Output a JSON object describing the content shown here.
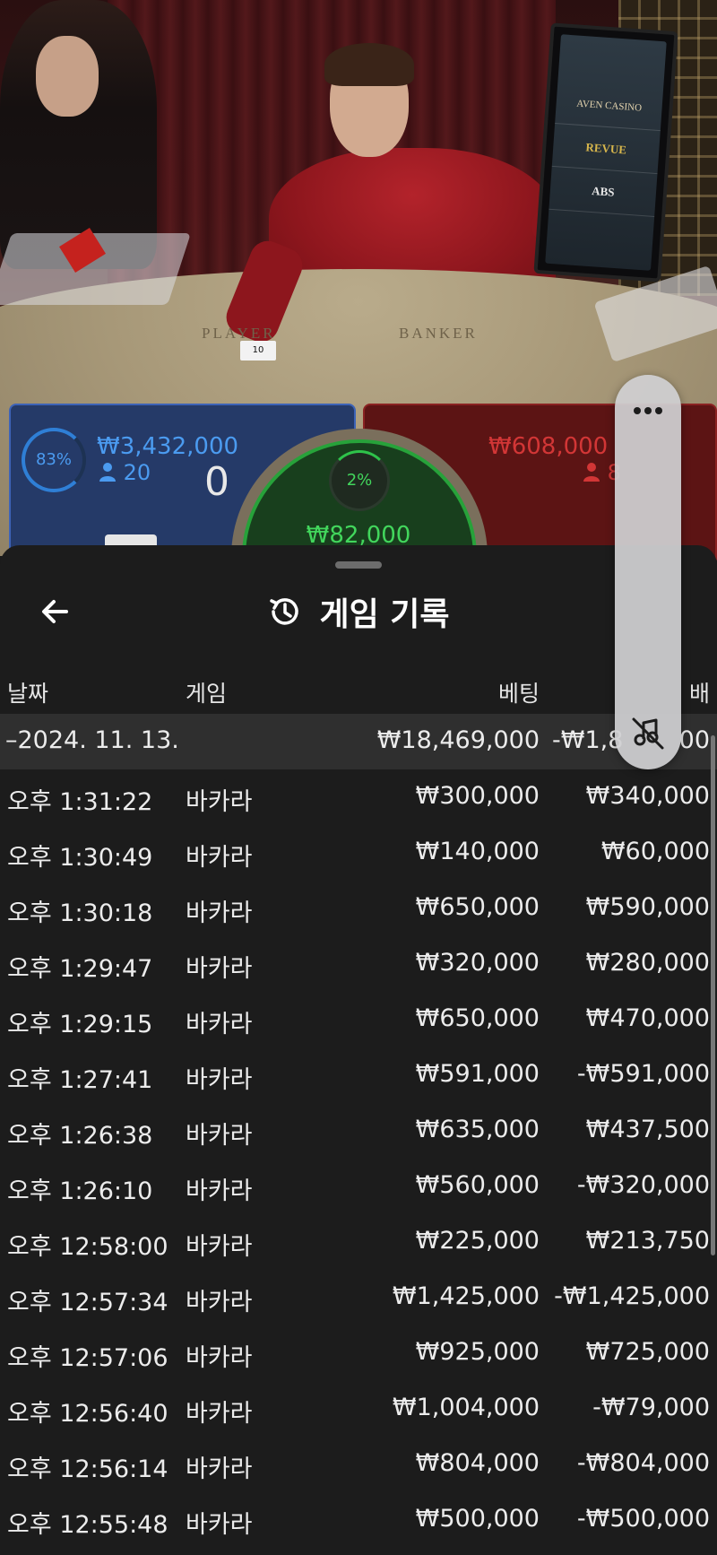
{
  "colors": {
    "player_blue": "#4b9bf0",
    "banker_red": "#d23636",
    "tie_green": "#42d65c",
    "sheet_bg": "#1c1c1c",
    "summary_row_bg": "#2f2f2f"
  },
  "video": {
    "monitor_brands": [
      "AVEN CASINO",
      "REVUE",
      "ABS"
    ],
    "table_labels": {
      "player": "PLAYER",
      "banker": "BANKER"
    },
    "card_value": "10"
  },
  "betting": {
    "player": {
      "percent": "83%",
      "amount": "₩3,432,000",
      "players": "20",
      "score": "0"
    },
    "tie": {
      "percent": "2%",
      "amount": "₩82,000"
    },
    "banker": {
      "amount": "₩608,000",
      "players": "8"
    }
  },
  "history": {
    "title": "게임 기록",
    "title_icon": "history-icon",
    "back_icon": "back-arrow-icon",
    "columns": {
      "date": "날짜",
      "game": "게임",
      "bet": "베팅",
      "payout": "배"
    },
    "summary": {
      "date": "–2024. 11. 13.",
      "bet": "₩18,469,000",
      "payout": "-₩1,8",
      "payout_tail": "00"
    },
    "rows": [
      {
        "time": "오후 1:31:22",
        "game": "바카라",
        "bet": "₩300,000",
        "payout": "₩340,000"
      },
      {
        "time": "오후 1:30:49",
        "game": "바카라",
        "bet": "₩140,000",
        "payout": "₩60,000"
      },
      {
        "time": "오후 1:30:18",
        "game": "바카라",
        "bet": "₩650,000",
        "payout": "₩590,000"
      },
      {
        "time": "오후 1:29:47",
        "game": "바카라",
        "bet": "₩320,000",
        "payout": "₩280,000"
      },
      {
        "time": "오후 1:29:15",
        "game": "바카라",
        "bet": "₩650,000",
        "payout": "₩470,000"
      },
      {
        "time": "오후 1:27:41",
        "game": "바카라",
        "bet": "₩591,000",
        "payout": "-₩591,000"
      },
      {
        "time": "오후 1:26:38",
        "game": "바카라",
        "bet": "₩635,000",
        "payout": "₩437,500"
      },
      {
        "time": "오후 1:26:10",
        "game": "바카라",
        "bet": "₩560,000",
        "payout": "-₩320,000"
      },
      {
        "time": "오후 12:58:00",
        "game": "바카라",
        "bet": "₩225,000",
        "payout": "₩213,750"
      },
      {
        "time": "오후 12:57:34",
        "game": "바카라",
        "bet": "₩1,425,000",
        "payout": "-₩1,425,000"
      },
      {
        "time": "오후 12:57:06",
        "game": "바카라",
        "bet": "₩925,000",
        "payout": "₩725,000"
      },
      {
        "time": "오후 12:56:40",
        "game": "바카라",
        "bet": "₩1,004,000",
        "payout": "-₩79,000"
      },
      {
        "time": "오후 12:56:14",
        "game": "바카라",
        "bet": "₩804,000",
        "payout": "-₩804,000"
      },
      {
        "time": "오후 12:55:48",
        "game": "바카라",
        "bet": "₩500,000",
        "payout": "-₩500,000"
      }
    ]
  },
  "floating_menu": {
    "more_icon": "more-dots-icon",
    "mute_icon": "sound-off-icon"
  }
}
